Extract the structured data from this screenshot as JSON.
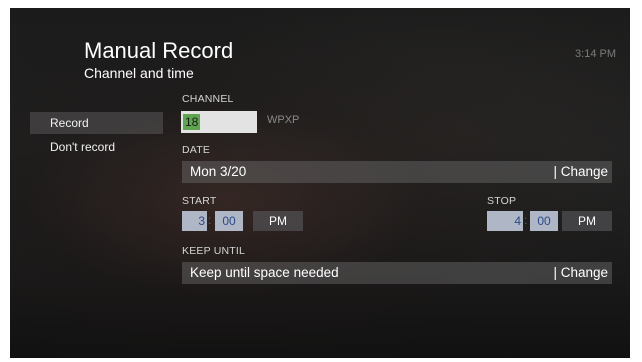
{
  "header": {
    "title": "Manual Record",
    "subtitle": "Channel and time",
    "clock": "3:14 PM"
  },
  "menu": {
    "items": [
      {
        "label": "Record",
        "selected": true
      },
      {
        "label": "Don't record",
        "selected": false
      }
    ]
  },
  "channel": {
    "label": "CHANNEL",
    "number": "18",
    "call_sign": "WPXP"
  },
  "date": {
    "label": "DATE",
    "value": "Mon 3/20",
    "change_label": "| Change"
  },
  "start": {
    "label": "START",
    "hour": "3",
    "separator": ":",
    "minute": "00",
    "ampm": "PM"
  },
  "stop": {
    "label": "STOP",
    "hour": "4",
    "separator": ":",
    "minute": "00",
    "ampm": "PM"
  },
  "keep_until": {
    "label": "KEEP UNTIL",
    "value": "Keep until space needed",
    "change_label": "| Change"
  },
  "colors": {
    "selection_highlight": "#5fa44e",
    "time_box": "#afb6c5",
    "time_text": "#2d4a8a"
  }
}
